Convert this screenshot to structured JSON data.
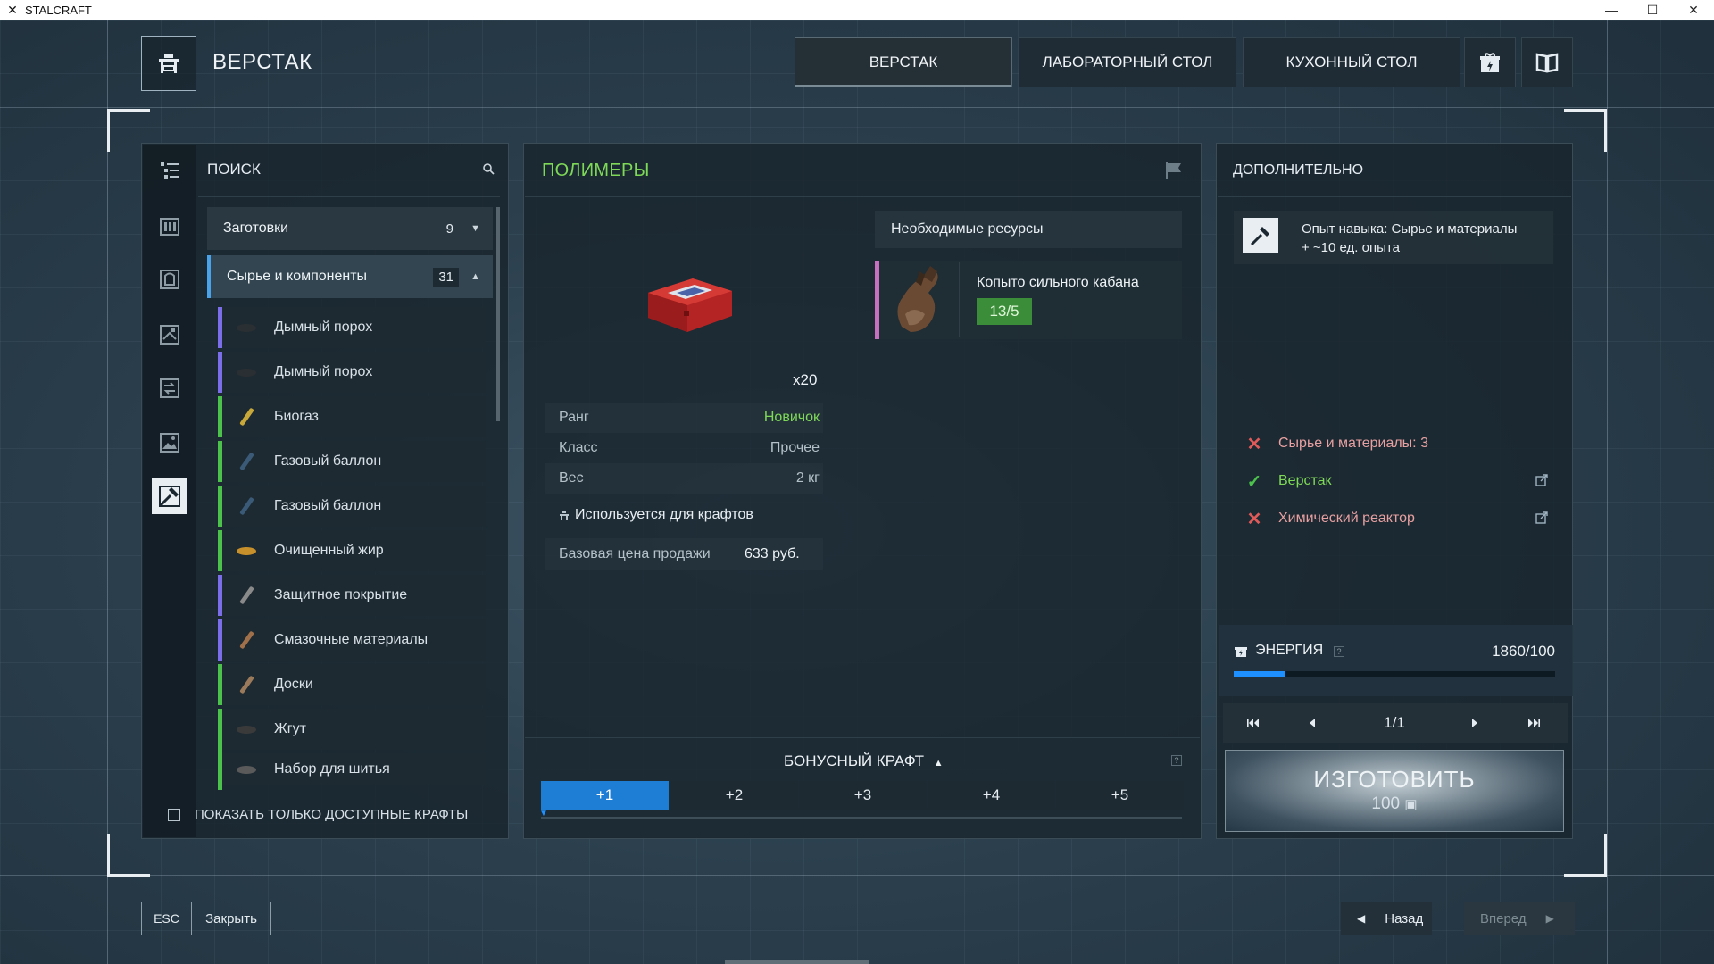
{
  "window": {
    "title": "STALCRAFT"
  },
  "header": {
    "page_title": "ВЕРСТАК",
    "tabs": [
      {
        "label": "ВЕРСТАК",
        "active": true
      },
      {
        "label": "ЛАБОРАТОРНЫЙ СТОЛ",
        "active": false
      },
      {
        "label": "КУХОННЫЙ СТОЛ",
        "active": false
      }
    ],
    "icon_tabs": [
      "gift-energy-icon",
      "book-icon"
    ]
  },
  "left_panel": {
    "search_label": "ПОИСК",
    "groups": [
      {
        "label": "Заготовки",
        "count": "9",
        "expanded": false
      },
      {
        "label": "Сырье и компоненты",
        "count": "31",
        "expanded": true
      }
    ],
    "items": [
      {
        "label": "Дымный порох",
        "color": "#7b6ee8"
      },
      {
        "label": "Дымный порох",
        "color": "#7b6ee8"
      },
      {
        "label": "Биогаз",
        "color": "#4cc24c"
      },
      {
        "label": "Газовый баллон",
        "color": "#4cc24c"
      },
      {
        "label": "Газовый баллон",
        "color": "#4cc24c"
      },
      {
        "label": "Очищенный жир",
        "color": "#4cc24c"
      },
      {
        "label": "Защитное покрытие",
        "color": "#7b6ee8"
      },
      {
        "label": "Смазочные материалы",
        "color": "#7b6ee8"
      },
      {
        "label": "Доски",
        "color": "#4cc24c"
      },
      {
        "label": "Жгут",
        "color": "#4cc24c"
      },
      {
        "label": "Набор для шитья",
        "color": "#4cc24c"
      }
    ],
    "show_available_label": "ПОКАЗАТЬ ТОЛЬКО ДОСТУПНЫЕ КРАФТЫ",
    "show_available_checked": false
  },
  "center_panel": {
    "title": "ПОЛИМЕРЫ",
    "title_color": "#7ed957",
    "multiplier": "x20",
    "resources_header": "Необходимые ресурсы",
    "resource": {
      "name": "Копыто сильного кабана",
      "count": "13/5"
    },
    "stats": [
      {
        "key": "Ранг",
        "value": "Новичок",
        "value_color": "#7ed957"
      },
      {
        "key": "Класс",
        "value": "Прочее"
      },
      {
        "key": "Вес",
        "value": "2 кг"
      }
    ],
    "uses_label": "Используется для крафтов",
    "price_key": "Базовая цена продажи",
    "price_value": "633 руб.",
    "bonus_title": "БОНУСНЫЙ КРАФТ",
    "bonus_tabs": [
      "+1",
      "+2",
      "+3",
      "+4",
      "+5"
    ],
    "bonus_active_index": 0
  },
  "right_panel": {
    "title": "ДОПОЛНИТЕЛЬНО",
    "skill_line1": "Опыт навыка: Сырье и материалы",
    "skill_line2": "+ ~10 ед. опыта",
    "requirements": [
      {
        "label": "Сырье и материалы: 3",
        "met": false,
        "link": false
      },
      {
        "label": "Верстак",
        "met": true,
        "link": true
      },
      {
        "label": "Химический реактор",
        "met": false,
        "link": true
      }
    ],
    "energy_label": "ЭНЕРГИЯ",
    "energy_value": "1860/100",
    "energy_fill_fraction": 0.16,
    "page_count": "1/1",
    "craft_label": "ИЗГОТОВИТЬ",
    "craft_cost": "100"
  },
  "footer": {
    "esc_key": "ESC",
    "esc_label": "Закрыть",
    "back_label": "Назад",
    "forward_label": "Вперед"
  },
  "colors": {
    "accent_blue": "#1e7ed6",
    "ok_green": "#4cc24c",
    "fail_red": "#e05a5a",
    "req_pink": "#e8a0a0"
  }
}
